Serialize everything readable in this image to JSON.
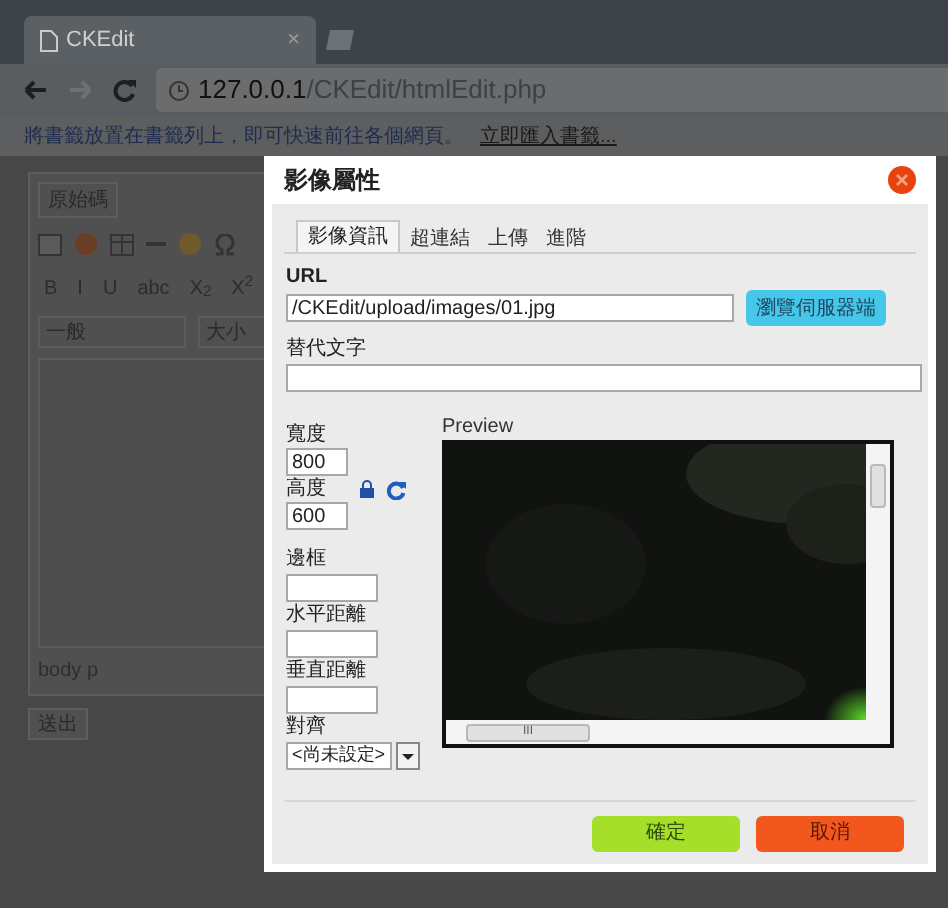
{
  "browser": {
    "tab_title": "CKEdit",
    "tab_close": "×",
    "address_host": "127.0.0.1",
    "address_path": "/CKEdit/htmlEdit.php",
    "bookmark_text": "將書籤放置在書籤列上，即可快速前往各個網頁。",
    "bookmark_link": "立即匯入書籤..."
  },
  "editor": {
    "source_button": "原始碼",
    "format_buttons": [
      "B",
      "I",
      "U",
      "abc",
      "X$_{2}$",
      "X$^{2}$"
    ],
    "format_select": "一般",
    "size_select": "大小",
    "path": "body p",
    "submit": "送出"
  },
  "dialog": {
    "title": "影像屬性",
    "tabs": [
      {
        "label": "影像資訊",
        "selected": true
      },
      {
        "label": "超連結",
        "selected": false
      },
      {
        "label": "上傳",
        "selected": false
      },
      {
        "label": "進階",
        "selected": false
      }
    ],
    "url_label": "URL",
    "url_value": "/CKEdit/upload/images/01.jpg",
    "browse_button": "瀏覽伺服器端",
    "alt_label": "替代文字",
    "width_label": "寬度",
    "width_value": "800",
    "height_label": "高度",
    "height_value": "600",
    "border_label": "邊框",
    "hspace_label": "水平距離",
    "vspace_label": "垂直距離",
    "align_label": "對齊",
    "align_value": "<尚未設定>",
    "preview_label": "Preview",
    "preview_scroll_grip": "III",
    "ok_button": "確定",
    "cancel_button": "取消"
  }
}
